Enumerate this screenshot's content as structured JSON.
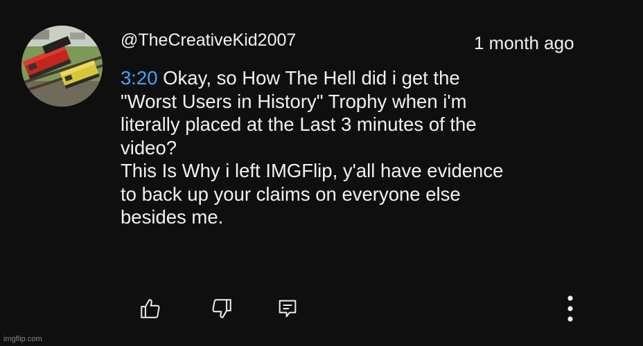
{
  "comment": {
    "author": "@TheCreativeKid2007",
    "time_ago": "1 month ago",
    "timestamp_link": "3:20",
    "first_line_rest": " Okay, so How The Hell did i get the",
    "lines": [
      "\"Worst Users in History\" Trophy when i'm",
      "literally placed at the Last 3 minutes of the",
      "video?",
      "This Is Why i left IMGFlip, y'all have evidence",
      "to back up your claims on everyone else",
      "besides me."
    ]
  },
  "actions": {
    "like_icon": "thumbs-up-icon",
    "dislike_icon": "thumbs-down-icon",
    "reply_icon": "reply-comment-icon",
    "more_icon": "vertical-dots-icon"
  },
  "watermark": "imgflip.com",
  "colors": {
    "background": "#0f0f0f",
    "text": "#f1f1f1",
    "link": "#3ea6ff"
  }
}
